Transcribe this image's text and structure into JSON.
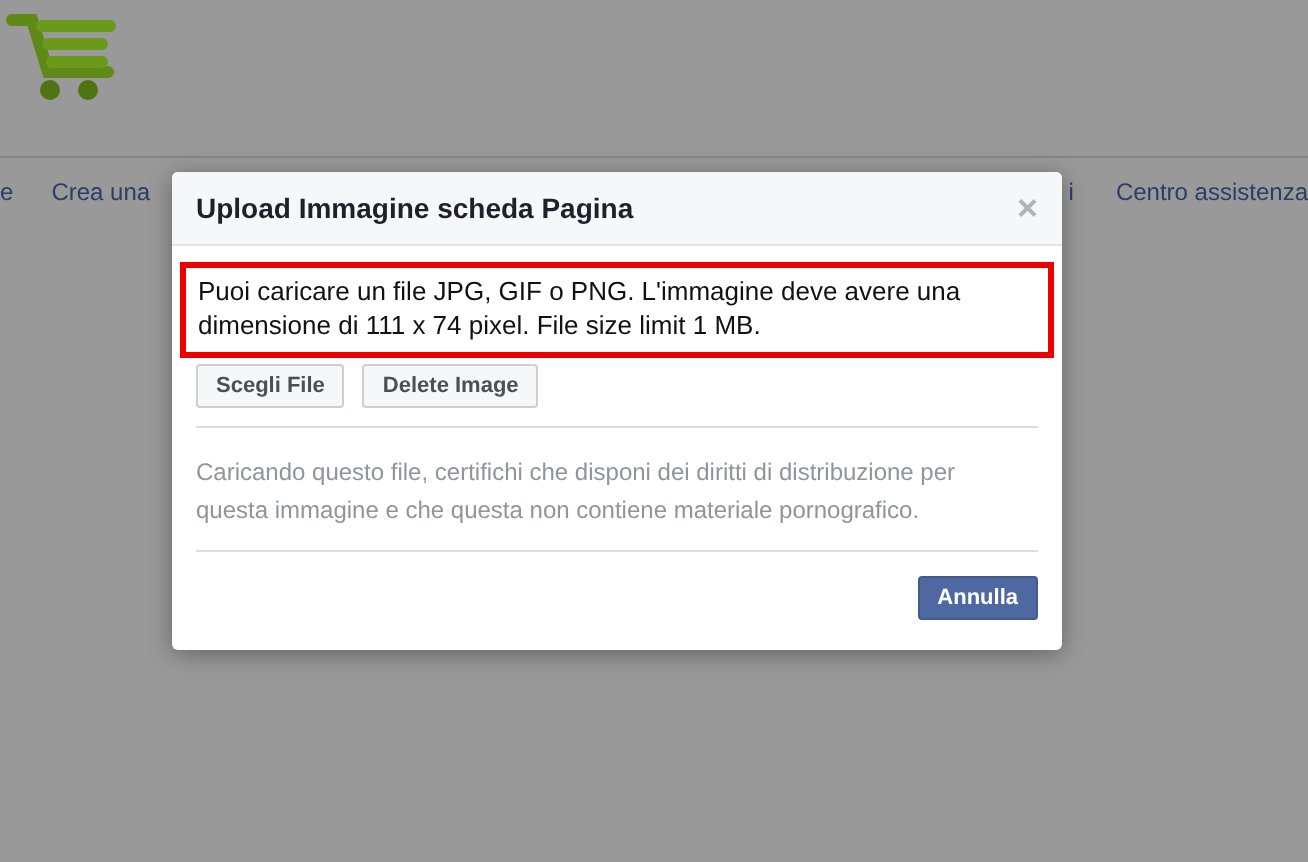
{
  "nav": {
    "items": [
      "e",
      "Crea una",
      "i",
      "Centro assistenza"
    ]
  },
  "dialog": {
    "title": "Upload Immagine scheda Pagina",
    "close": "×",
    "notice": "Puoi caricare un file JPG, GIF o PNG. L'immagine deve avere una dimensione di 111 x 74 pixel. File size limit 1 MB.",
    "buttons": [
      "Scegli File",
      "Delete Image"
    ],
    "disclaimer": "Caricando questo file, certifichi che disponi dei diritti di distribuzione per questa immagine e che questa non contiene materiale pornografico.",
    "cancel_button": "Annulla"
  }
}
